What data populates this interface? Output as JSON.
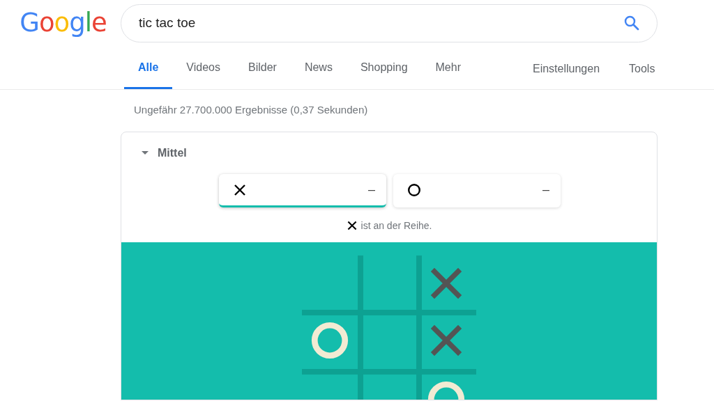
{
  "logo": "Google",
  "search": {
    "value": "tic tac toe"
  },
  "tabs": [
    {
      "label": "Alle",
      "selected": true
    },
    {
      "label": "Videos",
      "selected": false
    },
    {
      "label": "Bilder",
      "selected": false
    },
    {
      "label": "News",
      "selected": false
    },
    {
      "label": "Shopping",
      "selected": false
    },
    {
      "label": "Mehr",
      "selected": false
    }
  ],
  "tools": [
    "Einstellungen",
    "Tools"
  ],
  "result_stats": "Ungefähr 27.700.000 Ergebnisse (0,37 Sekunden)",
  "game": {
    "difficulty": "Mittel",
    "players": [
      {
        "kind": "x",
        "score": "–",
        "selected": true
      },
      {
        "kind": "o",
        "score": "–",
        "selected": false
      }
    ],
    "turn": {
      "kind": "x",
      "text": "ist an der Reihe."
    },
    "board": [
      [
        {
          "kind": "empty"
        },
        {
          "kind": "empty"
        },
        {
          "kind": "x"
        }
      ],
      [
        {
          "kind": "o"
        },
        {
          "kind": "empty"
        },
        {
          "kind": "x"
        }
      ],
      [
        {
          "kind": "empty"
        },
        {
          "kind": "empty"
        },
        {
          "kind": "o"
        }
      ]
    ]
  }
}
